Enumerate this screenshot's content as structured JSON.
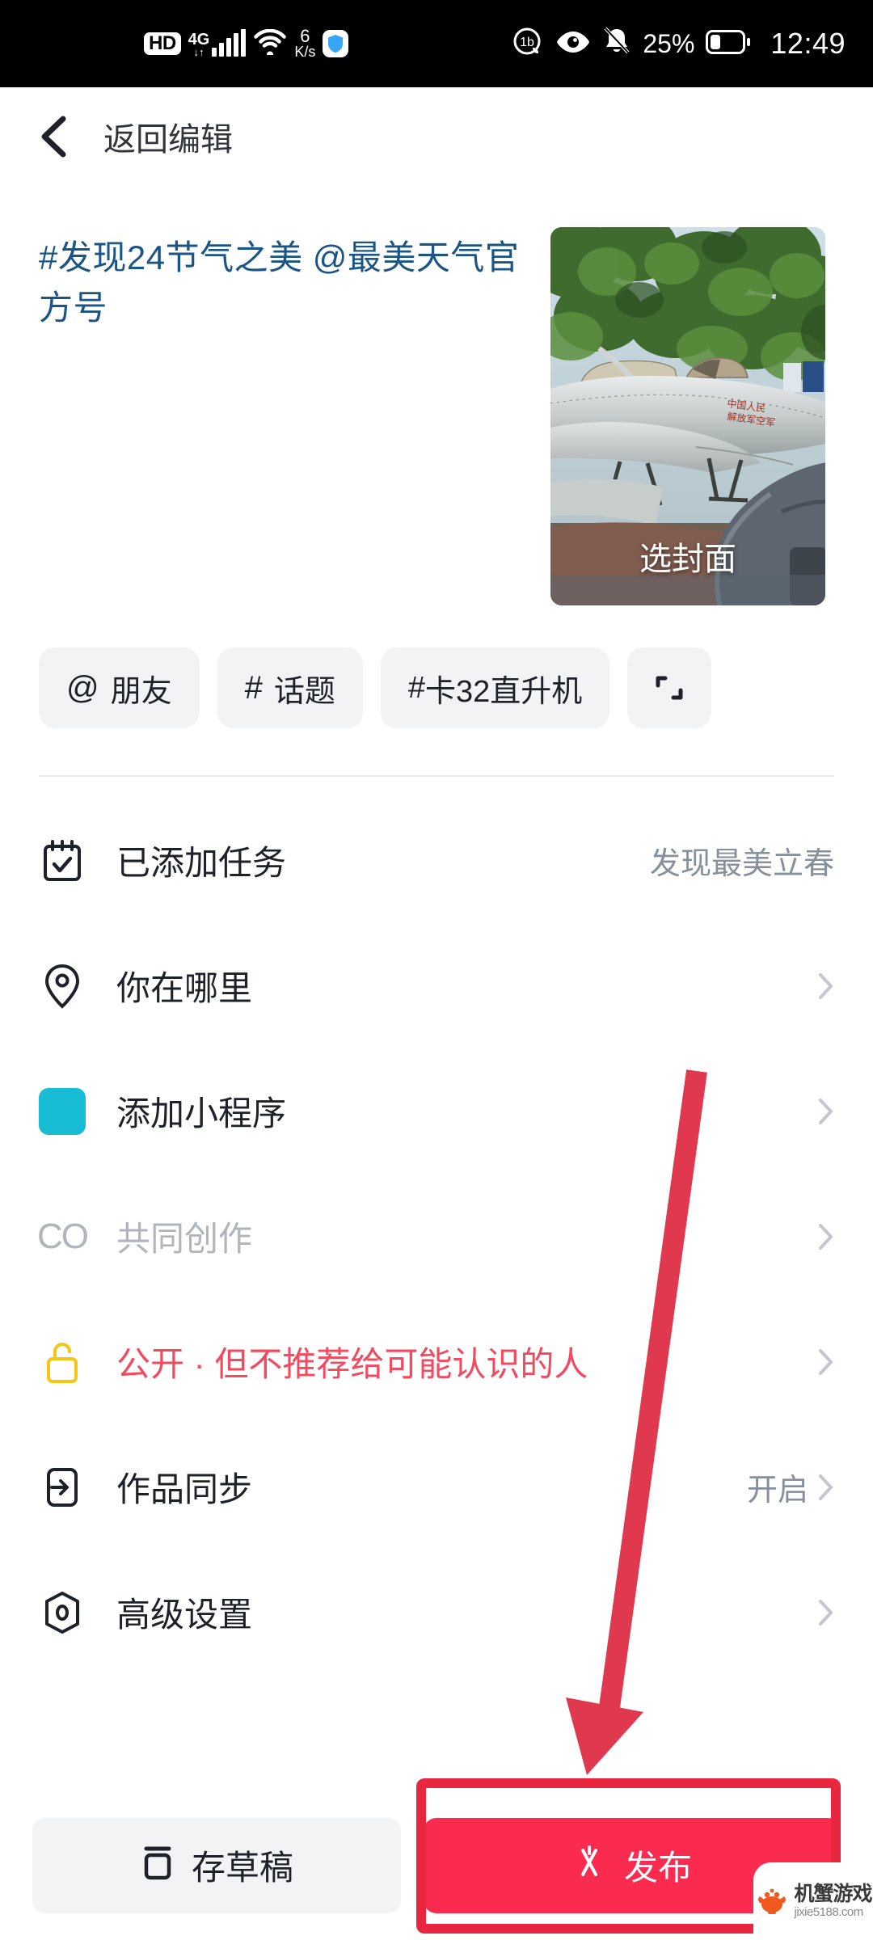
{
  "statusbar": {
    "hd": "HD",
    "network": "4G",
    "network_sub": "↓↑",
    "speed_value": "6",
    "speed_unit": "K/s",
    "battery_percent": "25%",
    "time": "12:49",
    "icons": [
      "hd-badge",
      "signal-4g-icon",
      "wifi-icon",
      "network-speed-icon",
      "shield-icon",
      "sound-mode-icon",
      "eye-care-icon",
      "bell-muted-icon",
      "battery-icon"
    ]
  },
  "navbar": {
    "back_label": "返回编辑"
  },
  "compose": {
    "caption": "#发现24节气之美 @最美天气官方号",
    "cover_label": "选封面"
  },
  "chips": [
    {
      "prefix": "@",
      "label": "朋友",
      "name": "chip-friend"
    },
    {
      "prefix": "#",
      "label": "话题",
      "name": "chip-topic"
    },
    {
      "prefix": "#",
      "label": "卡32直升机",
      "name": "chip-hashtag-ka32"
    },
    {
      "prefix": "",
      "label": "",
      "name": "chip-resize-icon"
    }
  ],
  "rows": [
    {
      "icon": "task-calendar-icon",
      "label": "已添加任务",
      "value": "发现最美立春",
      "chevron": false,
      "style": "normal"
    },
    {
      "icon": "location-pin-icon",
      "label": "你在哪里",
      "value": "",
      "chevron": true,
      "style": "normal"
    },
    {
      "icon": "mini-program-icon",
      "label": "添加小程序",
      "value": "",
      "chevron": true,
      "style": "normal"
    },
    {
      "icon": "co-creation-icon",
      "label": "共同创作",
      "value": "",
      "chevron": true,
      "style": "muted"
    },
    {
      "icon": "unlock-icon",
      "label": "公开 · 但不推荐给可能认识的人",
      "value": "",
      "chevron": true,
      "style": "danger"
    },
    {
      "icon": "sync-icon",
      "label": "作品同步",
      "value": "开启",
      "chevron": true,
      "style": "normal"
    },
    {
      "icon": "advanced-settings-icon",
      "label": "高级设置",
      "value": "",
      "chevron": true,
      "style": "normal"
    }
  ],
  "bottombar": {
    "draft_label": "存草稿",
    "publish_label": "发布"
  },
  "watermark": {
    "name": "机蟹游戏",
    "url": "jixie5188.com"
  },
  "colors": {
    "accent_red": "#fa2b4e",
    "annotation_red": "#e8263f",
    "caption_blue": "#1b5586",
    "danger_text": "#f24a5f",
    "mini_app_cyan": "#18bcd4",
    "unlock_yellow": "#f5c518",
    "muted_gray": "#b0b4bb",
    "value_gray": "#86909c"
  }
}
